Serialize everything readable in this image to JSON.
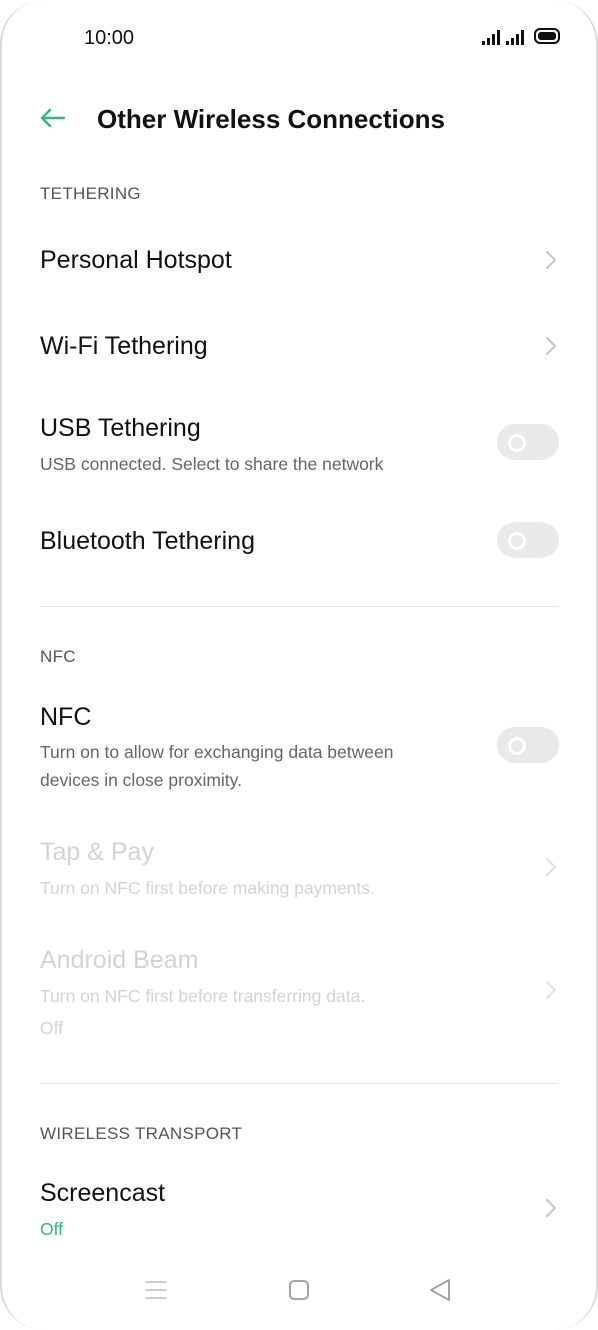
{
  "status": {
    "time": "10:00"
  },
  "header": {
    "title": "Other Wireless Connections"
  },
  "tethering": {
    "label": "TETHERING",
    "personal_hotspot": "Personal Hotspot",
    "wifi_tethering": "Wi-Fi Tethering",
    "usb_tethering": {
      "title": "USB Tethering",
      "subtitle": "USB connected. Select to share the network",
      "enabled": false
    },
    "bluetooth_tethering": {
      "title": "Bluetooth Tethering",
      "enabled": false
    }
  },
  "nfc": {
    "label": "NFC",
    "nfc_item": {
      "title": "NFC",
      "subtitle_line1": "Turn on to allow for exchanging data between",
      "subtitle_line2": "devices in close proximity.",
      "enabled": false
    },
    "tap_pay": {
      "title": "Tap & Pay",
      "subtitle": "Turn on NFC first before making payments."
    },
    "android_beam": {
      "title": "Android Beam",
      "subtitle": "Turn on NFC first before transferring data.",
      "status": "Off"
    }
  },
  "wireless_transport": {
    "label": "WIRELESS TRANSPORT",
    "screencast": {
      "title": "Screencast",
      "status": "Off"
    }
  },
  "colors": {
    "accent": "#2fb883",
    "toggle_off": "#e9e9e9"
  },
  "icons": [
    "back-arrow-icon",
    "chevron-right-icon",
    "menu-icon",
    "home-icon",
    "back-icon",
    "signal-icon",
    "battery-icon"
  ]
}
